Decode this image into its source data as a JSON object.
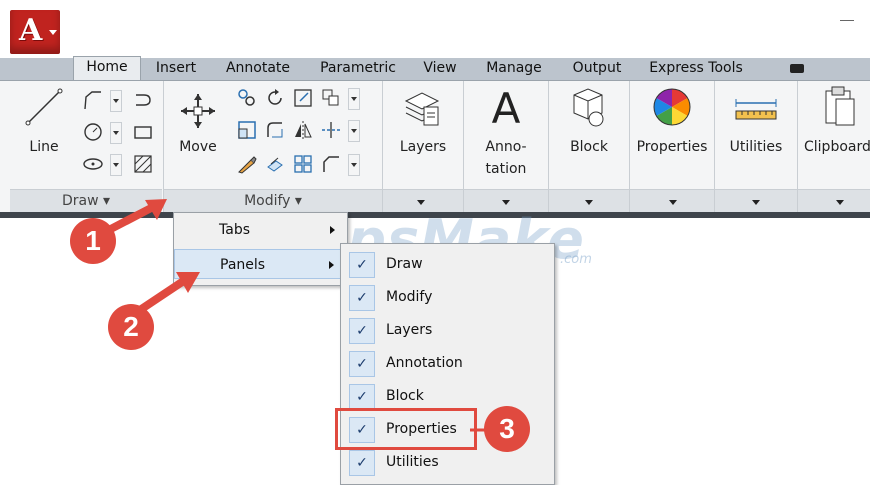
{
  "app_button": {
    "letter": "A"
  },
  "tabs": [
    {
      "label": "Home",
      "active": true
    },
    {
      "label": "Insert"
    },
    {
      "label": "Annotate"
    },
    {
      "label": "Parametric"
    },
    {
      "label": "View"
    },
    {
      "label": "Manage"
    },
    {
      "label": "Output"
    },
    {
      "label": "Express Tools"
    }
  ],
  "ribbon": {
    "draw": {
      "title": "Draw ▾",
      "line_label": "Line"
    },
    "modify": {
      "title": "Modify ▾",
      "move_label": "Move"
    },
    "layers": {
      "label": "Layers"
    },
    "annotation": {
      "glyph": "A",
      "label_line1": "Anno-",
      "label_line2": "tation"
    },
    "block": {
      "label": "Block"
    },
    "properties": {
      "label": "Properties"
    },
    "utilities": {
      "label": "Utilities"
    },
    "clipboard": {
      "label": "Clipboard"
    }
  },
  "context_menu": {
    "items": [
      {
        "label": "Tabs",
        "submenu": true
      },
      {
        "label": "Panels",
        "submenu": true,
        "highlighted": true
      }
    ]
  },
  "panels_submenu": {
    "check_glyph": "✓",
    "items": [
      {
        "label": "Draw",
        "checked": true
      },
      {
        "label": "Modify",
        "checked": true
      },
      {
        "label": "Layers",
        "checked": true
      },
      {
        "label": "Annotation",
        "checked": true
      },
      {
        "label": "Block",
        "checked": true
      },
      {
        "label": "Properties",
        "checked": true,
        "emphasized": true
      },
      {
        "label": "Utilities",
        "checked": true
      }
    ]
  },
  "watermark": {
    "text": "TipsMake",
    "suffix": ".com"
  },
  "callouts": [
    "1",
    "2",
    "3"
  ],
  "colors": {
    "callout": "#e04a3f",
    "app_red": "#c0231f",
    "ribbon_bg": "#f4f5f6",
    "tab_strip": "#bcc4cd"
  }
}
